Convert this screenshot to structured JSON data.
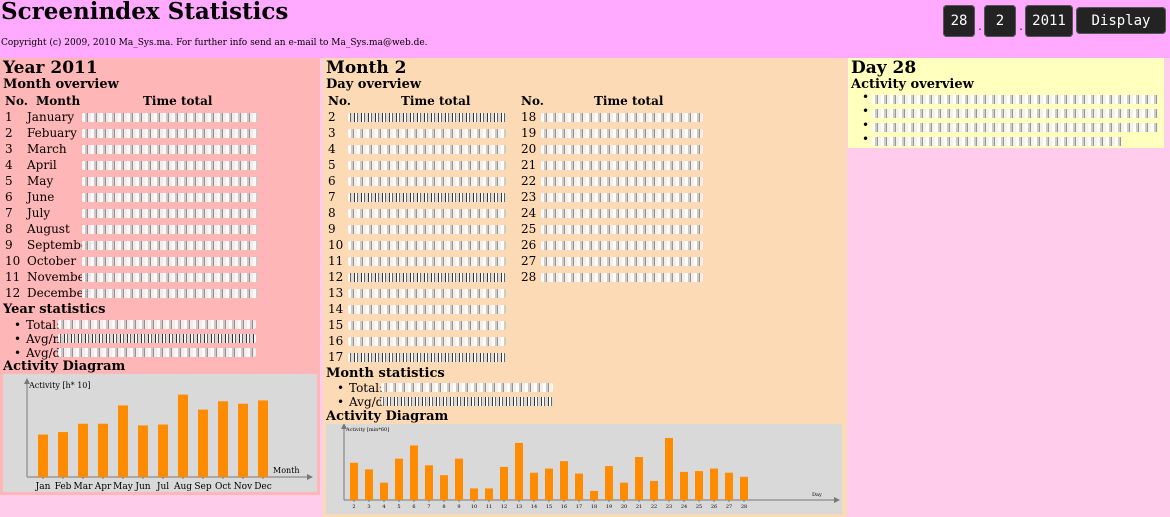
{
  "header": {
    "title": "Screenindex Statistics",
    "copyright": "Copyright (c) 2009, 2010 Ma_Sys.ma. For further info send an e-mail to Ma_Sys.ma@web.de.",
    "day_value": "28",
    "month_value": "2",
    "year_value": "2011",
    "separator": ".",
    "display_label": "Display"
  },
  "year_panel": {
    "title": "Year 2011",
    "overview_title": "Month overview",
    "col_no": "No.",
    "col_month": "Month",
    "col_time": "Time total",
    "rows": [
      {
        "no": "1",
        "name": "January"
      },
      {
        "no": "2",
        "name": "Febuary"
      },
      {
        "no": "3",
        "name": "March"
      },
      {
        "no": "4",
        "name": "April"
      },
      {
        "no": "5",
        "name": "May"
      },
      {
        "no": "6",
        "name": "June"
      },
      {
        "no": "7",
        "name": "July"
      },
      {
        "no": "8",
        "name": "August"
      },
      {
        "no": "9",
        "name": "September"
      },
      {
        "no": "10",
        "name": "October"
      },
      {
        "no": "11",
        "name": "November"
      },
      {
        "no": "12",
        "name": "December"
      }
    ],
    "stats_title": "Year statistics",
    "stats": [
      "Total:",
      "Avg/m",
      "Avg/d"
    ],
    "diagram_title": "Activity Diagram"
  },
  "month_panel": {
    "title": "Month 2",
    "overview_title": "Day overview",
    "col_no": "No.",
    "col_time": "Time total",
    "left_days": [
      "2",
      "3",
      "4",
      "5",
      "6",
      "7",
      "8",
      "9",
      "10",
      "11",
      "12",
      "13",
      "14",
      "15",
      "16",
      "17"
    ],
    "right_days": [
      "18",
      "19",
      "20",
      "21",
      "22",
      "23",
      "24",
      "25",
      "26",
      "27",
      "28"
    ],
    "stats_title": "Month statistics",
    "stats": [
      "Total:",
      "Avg/d"
    ],
    "diagram_title": "Activity Diagram"
  },
  "day_panel": {
    "title": "Day 28",
    "overview_title": "Activity overview"
  },
  "chart_data": [
    {
      "type": "bar",
      "ylabel": "Activity [h* 10]",
      "xlabel": "Month",
      "categories": [
        "Jan",
        "Feb",
        "Mar",
        "Apr",
        "May",
        "Jun",
        "Jul",
        "Aug",
        "Sep",
        "Oct",
        "Nov",
        "Dec"
      ],
      "values": [
        51,
        54,
        64,
        64,
        86,
        62,
        63,
        99,
        81,
        91,
        88,
        92
      ],
      "color": "#ff8c00"
    },
    {
      "type": "bar",
      "ylabel": "Activity [min*60]",
      "xlabel": "Day",
      "categories": [
        "2",
        "3",
        "4",
        "5",
        "6",
        "7",
        "8",
        "9",
        "10",
        "11",
        "12",
        "13",
        "14",
        "15",
        "16",
        "17",
        "18",
        "19",
        "20",
        "21",
        "22",
        "23",
        "24",
        "25",
        "26",
        "27",
        "28"
      ],
      "values": [
        45,
        37,
        21,
        50,
        66,
        42,
        30,
        50,
        14,
        14,
        40,
        69,
        33,
        38,
        47,
        32,
        11,
        41,
        21,
        52,
        23,
        75,
        34,
        35,
        38,
        33,
        28
      ],
      "color": "#ff8c00"
    }
  ]
}
